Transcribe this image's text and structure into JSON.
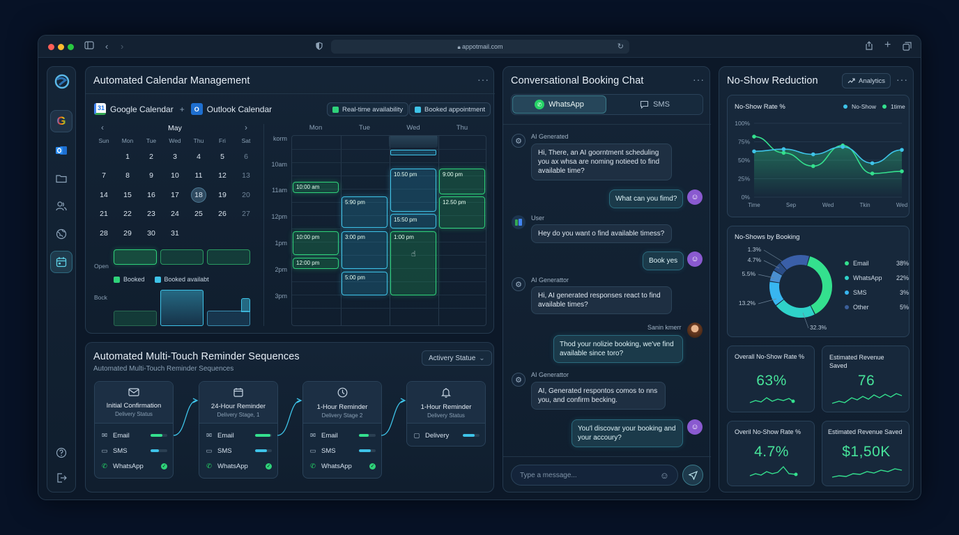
{
  "browser": {
    "url": "appotmail.com"
  },
  "calendar": {
    "title": "Automated Calendar Management",
    "google": "Google Calendar",
    "outlook": "Outlook Calendar",
    "chip_realtime": "Real-time availability",
    "chip_booked": "Booked appointment",
    "month": "May",
    "daynames": [
      "Sun",
      "Mon",
      "Tue",
      "Wed",
      "Thu",
      "Fri",
      "Sat"
    ],
    "weeks": [
      [
        "",
        "1",
        "2",
        "3",
        "4",
        "5",
        "6"
      ],
      [
        "7",
        "8",
        "9",
        "10",
        "11",
        "12",
        "13"
      ],
      [
        "14",
        "15",
        "16",
        "17",
        "18",
        "19",
        "20"
      ],
      [
        "21",
        "22",
        "23",
        "24",
        "25",
        "26",
        "27"
      ],
      [
        "28",
        "29",
        "30",
        "31",
        "",
        "",
        ""
      ]
    ],
    "selected_day": "18",
    "open_label": "Open",
    "legend_booked": "Booked",
    "legend_avail": "Booked availabt",
    "book_label": "Bock",
    "week_days": [
      "Mon",
      "Tue",
      "Wed",
      "Thu"
    ],
    "hours": [
      "korm",
      "10am",
      "11am",
      "12pm",
      "1pm",
      "2pm",
      "3pm"
    ],
    "events": {
      "e1": "10:00 am",
      "e2": "5:90 pm",
      "e3": "10.50 pm",
      "e4": "9:00 pm",
      "e5": "12.50 pm",
      "e6": "15:50 pm",
      "e7": "10:00 pm",
      "e8": "3:00 pm",
      "e9": "1:00 pm",
      "e10": "12:00 pm",
      "e11": "5:00 pm"
    }
  },
  "reminders": {
    "title": "Automated Multi-Touch Reminder Sequences",
    "subtitle": "Automated Multi-Touch Reminder Sequences",
    "dropdown": "Activery Statue",
    "steps": [
      {
        "title": "Initial Confirmation",
        "sub": "Delivery Status",
        "c1": "Email",
        "c2": "SMS",
        "c3": "WhatsApp",
        "f1": 0.7,
        "f2": 0.5
      },
      {
        "title": "24-Hour Reminder",
        "sub": "Delivery Stage, 1",
        "c1": "Email",
        "c2": "SMS",
        "c3": "WhatsApp",
        "f1": 0.9,
        "f2": 0.7
      },
      {
        "title": "1-Hour Reminder",
        "sub": "Delivery Stage 2",
        "c1": "Email",
        "c2": "SMS",
        "c3": "WhatsApp",
        "f1": 0.6,
        "f2": 0.7
      },
      {
        "title": "1-Hour Reminder",
        "sub": "Delivery Status",
        "c1": "Delivery",
        "f1": 0.7
      }
    ]
  },
  "chat": {
    "title": "Conversational Booking Chat",
    "tab_whatsapp": "WhatsApp",
    "tab_sms": "SMS",
    "m1_label": "AI Generated",
    "m1": "Hi, There, an AI goorntment scheduling you ax whsa are noming notieed to find available time?",
    "m2": "What can you fimd?",
    "m3_label": "User",
    "m3": "Hey do you want o find available timess?",
    "m4": "Book yes",
    "m5_label": "AI Generattor",
    "m5": "Hi, AI generated responses react to find available times?",
    "m6_label": "Sanin kmerr",
    "m6": "Thod your nolizie booking, we've find available since toro?",
    "m7_label": "AI Generattor",
    "m7": "AI, Generated respontos comos to nns you, and confirm becking.",
    "m8": "You'l discovar your booking and your accoury?",
    "input_placeholder": "Type a message..."
  },
  "noshow": {
    "title": "No-Show Reduction",
    "analytics_btn": "Analytics",
    "rate_title": "No-Show Rate %",
    "legend_a": "No-Show",
    "legend_b": "1time",
    "y_ticks": [
      "100%",
      "75%",
      "50%",
      "25%",
      "0%"
    ],
    "x_ticks": [
      "Time",
      "Sep",
      "Wed",
      "Tkin",
      "Wed"
    ],
    "series_a": [
      62,
      65,
      58,
      68,
      46,
      64
    ],
    "series_b": [
      82,
      60,
      42,
      70,
      32,
      35
    ],
    "donut_title": "No-Shows by Booking",
    "donut_labels": [
      "1.3%",
      "4.7%",
      "5.5%",
      "13.2%",
      "32.3%"
    ],
    "donut_legend": [
      {
        "name": "Email",
        "value": "38%",
        "color": "#34e08e"
      },
      {
        "name": "WhatsApp",
        "value": "22%",
        "color": "#2fd2c9"
      },
      {
        "name": "SMS",
        "value": "3%",
        "color": "#38b6f0"
      },
      {
        "name": "Other",
        "value": "5%",
        "color": "#3b5f9a"
      }
    ],
    "stat1_title": "Overall No-Show Rate %",
    "stat1_value": "63%",
    "stat2_title": "Estimated Revenue Saved",
    "stat2_value": "76",
    "stat3_title": "Overil No-Show Rate %",
    "stat3_value": "4.7%",
    "stat4_title": "Estimated Revenue Saved",
    "stat4_value": "$1,50K"
  },
  "colors": {
    "green": "#2fd27a",
    "cyan": "#3ec3e8",
    "accent_text": "#47e39a"
  }
}
